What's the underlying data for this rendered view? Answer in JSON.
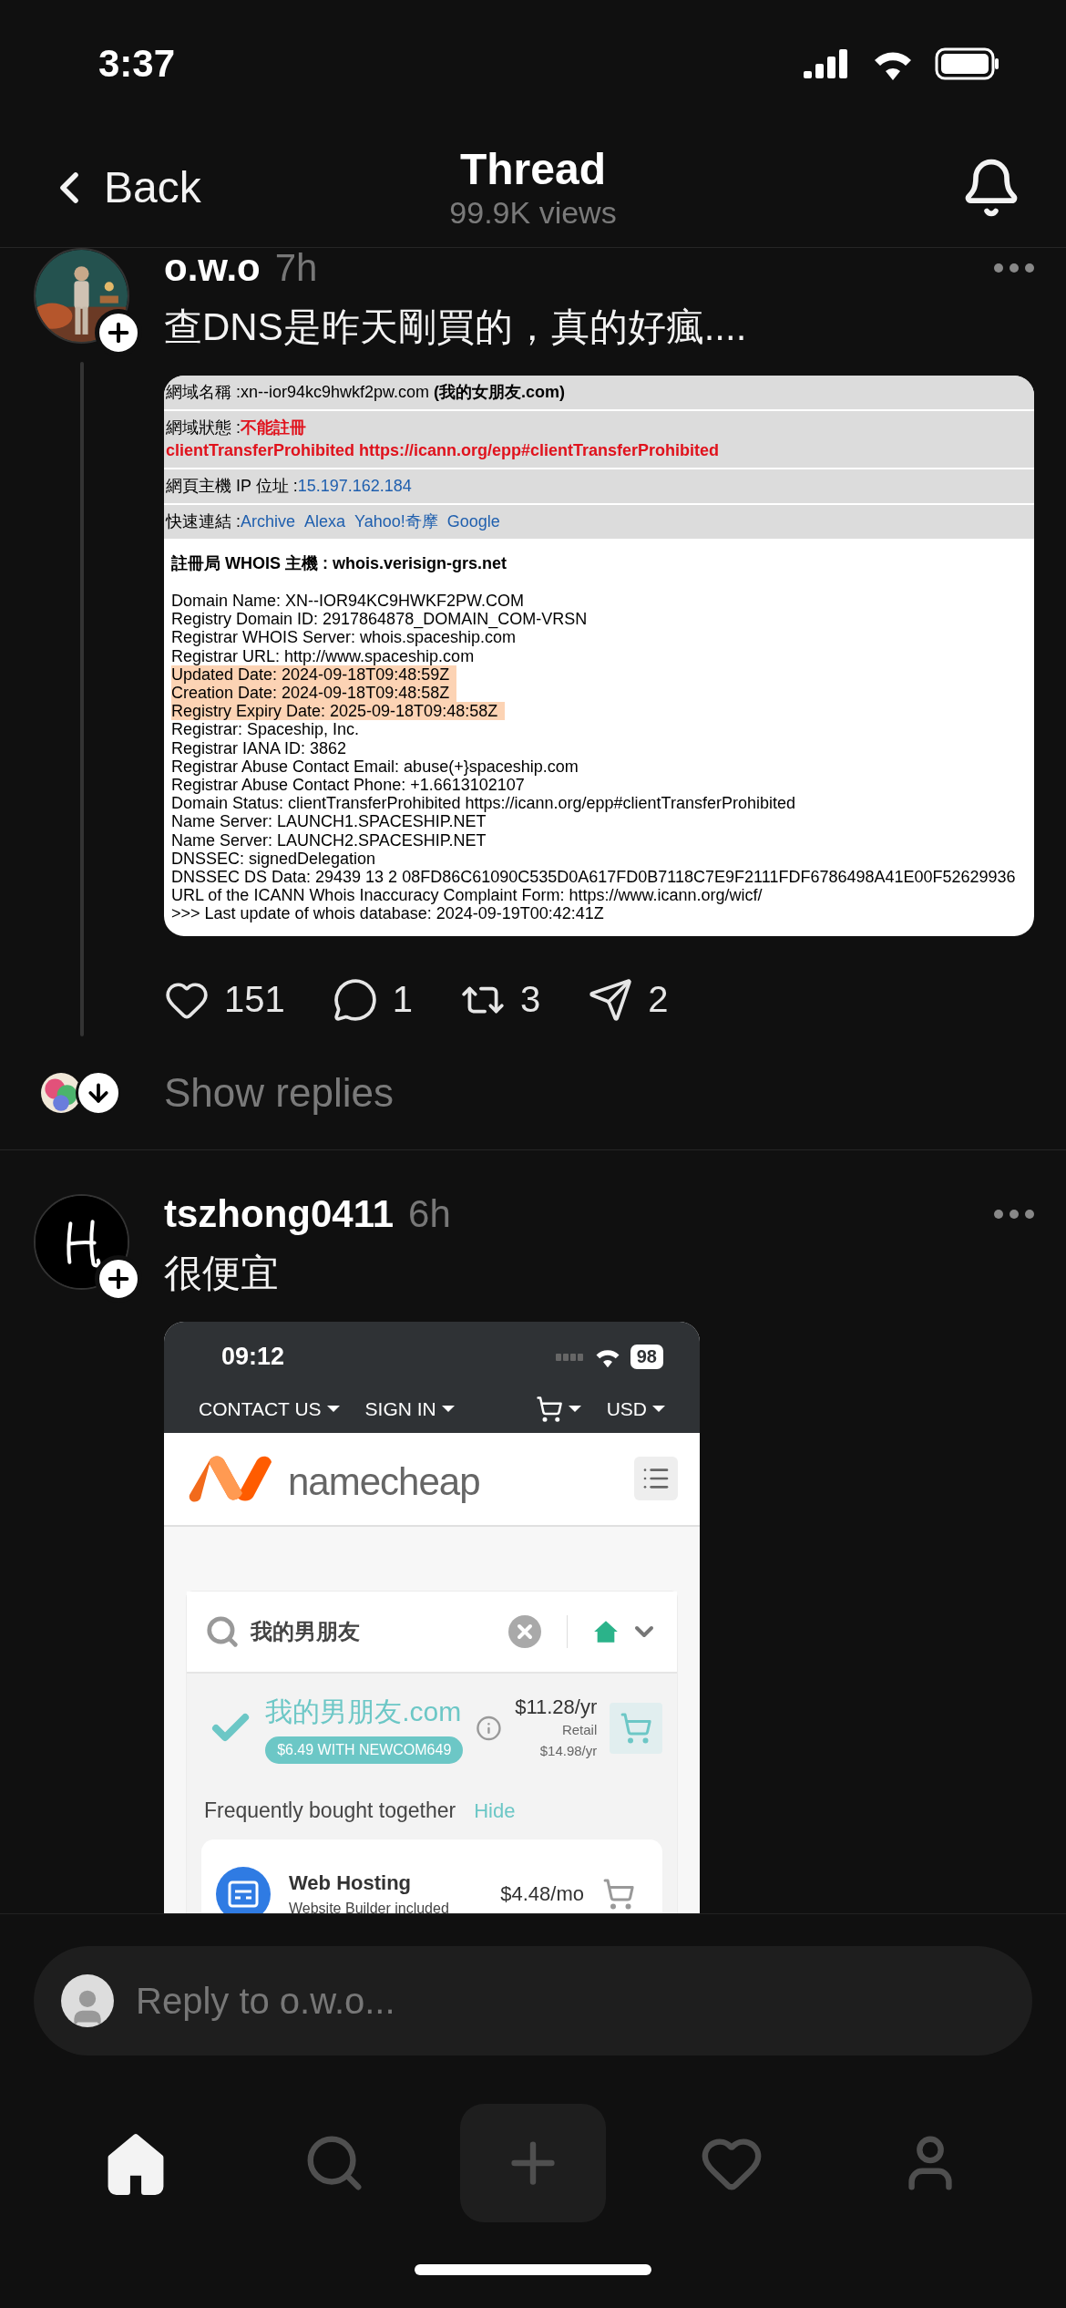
{
  "status_bar": {
    "time": "3:37"
  },
  "nav": {
    "back": "Back",
    "title": "Thread",
    "subtitle": "99.9K views"
  },
  "posts": [
    {
      "author": "o.w.o",
      "time": "7h",
      "avatar": {
        "kind": "picture"
      },
      "text": "查DNS是昨天剛買的，真的好瘋....",
      "attachment": {
        "kind": "whois",
        "summary": [
          {
            "kind": "plain",
            "label": "網域名稱 : ",
            "value": "xn--ior94kc9hwkf2pw.com **(我的女朋友.com)**"
          },
          {
            "kind": "alert",
            "label": "網域狀態 : ",
            "value": "不能註冊",
            "detail": "clientTransferProhibited https://icann.org/epp#clientTransferProhibited"
          },
          {
            "kind": "ip",
            "label": "網頁主機 IP 位址 : ",
            "value": "15.197.162.184"
          },
          {
            "kind": "links",
            "label": "快速連結 : ",
            "links": [
              "Archive",
              "Alexa",
              "Yahoo!奇摩",
              "Google"
            ]
          }
        ],
        "server_heading": "註冊局 WHOIS 主機 : whois.verisign-grs.net",
        "records": [
          {
            "text": "Domain Name: XN--IOR94KC9HWKF2PW.COM",
            "highlighted": false
          },
          {
            "text": "Registry Domain ID: 2917864878_DOMAIN_COM-VRSN",
            "highlighted": false
          },
          {
            "text": "Registrar WHOIS Server: whois.spaceship.com",
            "highlighted": false
          },
          {
            "text": "Registrar URL: http://www.spaceship.com",
            "highlighted": false
          },
          {
            "text": "Updated Date: 2024-09-18T09:48:59Z",
            "highlighted": true
          },
          {
            "text": "Creation Date: 2024-09-18T09:48:58Z",
            "highlighted": true
          },
          {
            "text": "Registry Expiry Date: 2025-09-18T09:48:58Z",
            "highlighted": true
          },
          {
            "text": "Registrar: Spaceship, Inc.",
            "highlighted": false
          },
          {
            "text": "Registrar IANA ID: 3862",
            "highlighted": false
          },
          {
            "text": "Registrar Abuse Contact Email: abuse(+}spaceship.com",
            "highlighted": false
          },
          {
            "text": "Registrar Abuse Contact Phone: +1.6613102107",
            "highlighted": false
          },
          {
            "text": "Domain Status: clientTransferProhibited https://icann.org/epp#clientTransferProhibited",
            "highlighted": false
          },
          {
            "text": "Name Server: LAUNCH1.SPACESHIP.NET",
            "highlighted": false
          },
          {
            "text": "Name Server: LAUNCH2.SPACESHIP.NET",
            "highlighted": false
          },
          {
            "text": "DNSSEC: signedDelegation",
            "highlighted": false
          },
          {
            "text": "DNSSEC DS Data: 29439 13 2 08FD86C61090C535D0A617FD0B7118C7E9F2111FDF6786498A41E00F52629936",
            "highlighted": false
          },
          {
            "text": "URL of the ICANN Whois Inaccuracy Complaint Form: https://www.icann.org/wicf/",
            "highlighted": false
          },
          {
            "text": ">>> Last update of whois database: 2024-09-19T00:42:41Z",
            "highlighted": false
          }
        ]
      },
      "actions": [
        {
          "kind": "like",
          "count": "151"
        },
        {
          "kind": "comment",
          "count": "1"
        },
        {
          "kind": "repost",
          "count": "3"
        },
        {
          "kind": "share",
          "count": "2"
        }
      ],
      "replies_link": "Show replies"
    },
    {
      "author": "tszhong0411",
      "time": "6h",
      "avatar": {
        "kind": "logo"
      },
      "text": "很便宜",
      "attachment": {
        "kind": "shop",
        "status_time": "09:12",
        "battery": "98",
        "nav": [
          {
            "kind": "text",
            "label": "CONTACT US"
          },
          {
            "kind": "text",
            "label": "SIGN IN"
          },
          {
            "kind": "cart"
          },
          {
            "kind": "text",
            "label": "USD"
          }
        ],
        "brand": "namecheap",
        "search": {
          "value": "我的男朋友"
        },
        "result": {
          "domain": "我的男朋友.com",
          "promo": "$6.49 WITH NEWCOM649",
          "price": "$11.28/yr",
          "retail_label": "Retail",
          "retail_price": "$14.98/yr"
        },
        "section": {
          "title": "Frequently bought together",
          "action": "Hide"
        },
        "product": {
          "name": "Web Hosting",
          "detail": "Website Builder included",
          "price": "$4.48/mo"
        }
      }
    }
  ],
  "composer": {
    "placeholder": "Reply to o.w.o..."
  },
  "tab_bar": [
    {
      "kind": "home",
      "selected": true
    },
    {
      "kind": "search",
      "selected": false
    },
    {
      "kind": "create",
      "selected": false
    },
    {
      "kind": "activity",
      "selected": false
    },
    {
      "kind": "profile",
      "selected": false
    }
  ]
}
